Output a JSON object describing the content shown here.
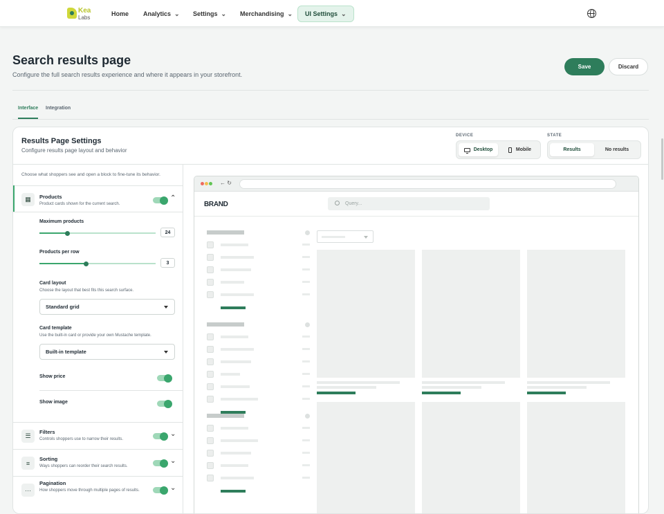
{
  "brand": {
    "name_line1": "Kea",
    "name_line2": "Labs"
  },
  "nav": {
    "items": [
      {
        "label": "Home",
        "chevron": false
      },
      {
        "label": "Analytics",
        "chevron": true
      },
      {
        "label": "Settings",
        "chevron": true
      },
      {
        "label": "Merchandising",
        "chevron": true
      },
      {
        "label": "UI Settings",
        "chevron": true,
        "active": true
      }
    ],
    "globe_icon": "globe-icon"
  },
  "page": {
    "title": "Search results page",
    "subtitle": "Configure the full search results experience and where it appears in your storefront.",
    "save_label": "Save",
    "discard_label": "Discard"
  },
  "tabs": [
    {
      "label": "Interface",
      "active": true
    },
    {
      "label": "Integration",
      "active": false
    }
  ],
  "card": {
    "title": "Results Page Settings",
    "subtitle": "Configure results page layout and behavior",
    "device": {
      "label": "DEVICE",
      "options": [
        "Desktop",
        "Mobile"
      ],
      "selected": "Desktop"
    },
    "state": {
      "label": "STATE",
      "options": [
        "Results",
        "No results"
      ],
      "selected": "Results"
    }
  },
  "panel": {
    "hint": "Choose what shoppers see and open a block to fine-tune its behavior.",
    "products": {
      "title": "Products",
      "desc": "Product cards shown for the current search.",
      "enabled": true,
      "expanded": true,
      "max_products": {
        "label": "Maximum products",
        "value": "24",
        "level": 0.24
      },
      "per_row": {
        "label": "Products per row",
        "value": "3",
        "level": 0.4
      },
      "card_layout": {
        "label": "Card layout",
        "desc": "Choose the layout that best fits this search surface.",
        "value": "Standard grid"
      },
      "card_template": {
        "label": "Card template",
        "desc": "Use the built-in card or provide your own Mustache template.",
        "value": "Built-in template"
      },
      "show_price": {
        "label": "Show price",
        "enabled": true
      },
      "show_image": {
        "label": "Show image",
        "enabled": true
      }
    },
    "filters": {
      "title": "Filters",
      "desc": "Controls shoppers use to narrow their results.",
      "enabled": true
    },
    "sorting": {
      "title": "Sorting",
      "desc": "Ways shoppers can reorder their search results.",
      "enabled": true
    },
    "pagination": {
      "title": "Pagination",
      "desc": "How shoppers move through multiple pages of results.",
      "enabled": true
    }
  },
  "preview": {
    "brand": "BRAND",
    "search_placeholder": "Query...",
    "dot_colors": [
      "#ee6a5f",
      "#f5bd4f",
      "#61c454"
    ],
    "accent": "#2e7d5b"
  }
}
